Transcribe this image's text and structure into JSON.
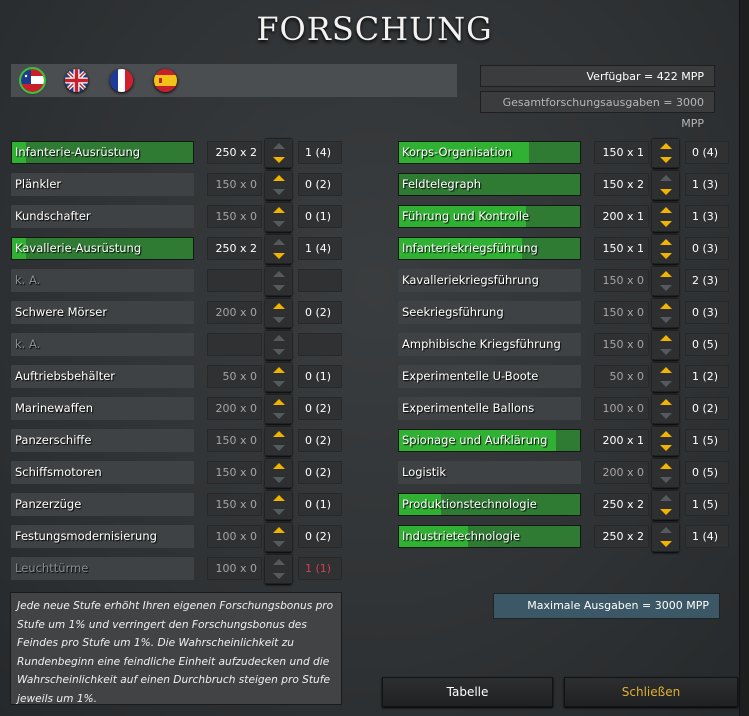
{
  "title": "FORSCHUNG",
  "flags": [
    {
      "name": "csa-flag",
      "selected": true
    },
    {
      "name": "uk-flag",
      "selected": false
    },
    {
      "name": "france-flag",
      "selected": false
    },
    {
      "name": "spain-flag",
      "selected": false
    }
  ],
  "summary": {
    "available": "Verfügbar =  422 MPP",
    "total_spending": "Gesamtforschungsausgaben =  3000 MPP",
    "max_spending": "Maximale Ausgaben =   3000 MPP"
  },
  "left_column": [
    {
      "name": "Infanterie-Ausrüstung",
      "cost": "250 x 2",
      "level": "1 (4)",
      "state": "active",
      "progress": 0.08,
      "up": false,
      "down": true
    },
    {
      "name": "Plänkler",
      "cost": "150 x 0",
      "level": "0 (2)",
      "state": "normal",
      "up": true,
      "down": false
    },
    {
      "name": "Kundschafter",
      "cost": "150 x 0",
      "level": "0 (1)",
      "state": "normal",
      "up": true,
      "down": false
    },
    {
      "name": "Kavallerie-Ausrüstung",
      "cost": "250 x 2",
      "level": "1 (4)",
      "state": "active",
      "progress": 0.08,
      "up": false,
      "down": true
    },
    {
      "name": "k. A.",
      "cost": "",
      "level": "",
      "state": "disabled",
      "up": false,
      "down": false
    },
    {
      "name": "Schwere Mörser",
      "cost": "200 x 0",
      "level": "0 (2)",
      "state": "normal",
      "up": true,
      "down": false
    },
    {
      "name": "k. A.",
      "cost": "",
      "level": "",
      "state": "disabled",
      "up": false,
      "down": false
    },
    {
      "name": "Auftriebsbehälter",
      "cost": "50 x 0",
      "level": "0 (1)",
      "state": "normal",
      "up": true,
      "down": false
    },
    {
      "name": "Marinewaffen",
      "cost": "200 x 0",
      "level": "0 (2)",
      "state": "normal",
      "up": true,
      "down": false
    },
    {
      "name": "Panzerschiffe",
      "cost": "150 x 0",
      "level": "0 (2)",
      "state": "normal",
      "up": true,
      "down": false
    },
    {
      "name": "Schiffsmotoren",
      "cost": "150 x 0",
      "level": "0 (2)",
      "state": "normal",
      "up": true,
      "down": false
    },
    {
      "name": "Panzerzüge",
      "cost": "150 x 0",
      "level": "0 (1)",
      "state": "normal",
      "up": true,
      "down": false
    },
    {
      "name": "Festungsmodernisierung",
      "cost": "100 x 0",
      "level": "0 (2)",
      "state": "normal",
      "up": true,
      "down": false
    },
    {
      "name": "Leuchttürme",
      "cost": "100 x 0",
      "level": "1 (1)",
      "state": "disabled",
      "level_color": "red",
      "up": false,
      "down": false
    }
  ],
  "right_column": [
    {
      "name": "Korps-Organisation",
      "cost": "150 x 1",
      "level": "0 (4)",
      "state": "active",
      "progress": 0.72,
      "up": true,
      "down": true
    },
    {
      "name": "Feldtelegraph",
      "cost": "150 x 2",
      "level": "1 (3)",
      "state": "active",
      "progress": 0.0,
      "up": false,
      "down": true
    },
    {
      "name": "Führung und Kontrolle",
      "cost": "200 x 1",
      "level": "1 (3)",
      "state": "active",
      "progress": 0.7,
      "up": true,
      "down": true
    },
    {
      "name": "Infanteriekriegsführung",
      "cost": "150 x 1",
      "level": "0 (3)",
      "state": "active",
      "progress": 0.68,
      "up": true,
      "down": true
    },
    {
      "name": "Kavalleriekriegsführung",
      "cost": "150 x 0",
      "level": "2 (3)",
      "state": "normal",
      "up": true,
      "down": false
    },
    {
      "name": "Seekriegsführung",
      "cost": "150 x 0",
      "level": "0 (3)",
      "state": "normal",
      "up": true,
      "down": false
    },
    {
      "name": "Amphibische Kriegsführung",
      "cost": "150 x 0",
      "level": "0 (5)",
      "state": "normal",
      "up": true,
      "down": false
    },
    {
      "name": "Experimentelle U-Boote",
      "cost": "50 x 0",
      "level": "1 (2)",
      "state": "normal",
      "up": true,
      "down": false
    },
    {
      "name": "Experimentelle Ballons",
      "cost": "100 x 0",
      "level": "0 (2)",
      "state": "normal",
      "up": true,
      "down": false
    },
    {
      "name": "Spionage und Aufklärung",
      "cost": "200 x 1",
      "level": "1 (5)",
      "state": "active",
      "progress": 0.87,
      "up": true,
      "down": true
    },
    {
      "name": "Logistik",
      "cost": "200 x 0",
      "level": "0 (5)",
      "state": "normal",
      "up": true,
      "down": false
    },
    {
      "name": "Produktionstechnologie",
      "cost": "250 x 2",
      "level": "1 (5)",
      "state": "active",
      "progress": 0.23,
      "up": false,
      "down": true
    },
    {
      "name": "Industrietechnologie",
      "cost": "250 x 2",
      "level": "1 (4)",
      "state": "active",
      "progress": 0.38,
      "up": false,
      "down": true
    }
  ],
  "description": "Jede neue Stufe erhöht Ihren eigenen Forschungsbonus pro Stufe um 1% und verringert den Forschungsbonus des Feindes pro Stufe um 1%. Die Wahrscheinlichkeit zu Rundenbeginn eine feindliche Einheit aufzudecken und die Wahrscheinlichkeit auf einen Durchbruch steigen pro Stufe jeweils um 1%.",
  "buttons": {
    "table": "Tabelle",
    "close": "Schließen"
  },
  "colors": {
    "accent": "#f0b400",
    "active_green": "#31b133",
    "close_text": "#e0b030",
    "level_red": "#d04050"
  }
}
